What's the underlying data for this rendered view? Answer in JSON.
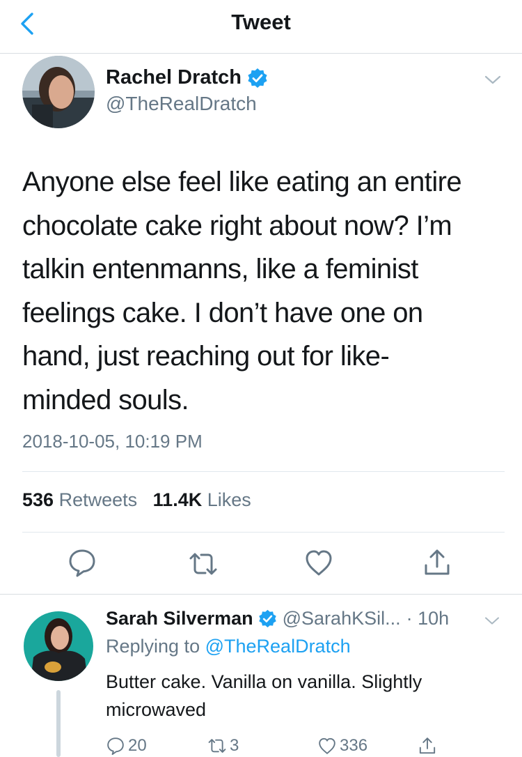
{
  "nav": {
    "title": "Tweet"
  },
  "tweet": {
    "author_name": "Rachel Dratch",
    "author_handle": "@TheRealDratch",
    "text_lines": [
      "Anyone else feel like eating an entire",
      "chocolate cake right about now? I’m",
      "talkin entenmanns, like a feminist",
      "feelings cake. I don’t have one on",
      "hand, just reaching out for like-",
      "minded souls."
    ],
    "timestamp": "2018-10-05, 10:19 PM",
    "retweets_count": "536",
    "retweets_label": "Retweets",
    "likes_count": "11.4K",
    "likes_label": "Likes"
  },
  "reply": {
    "author_name": "Sarah Silverman",
    "author_handle": "@SarahKSil...",
    "time": "· 10h",
    "replying_prefix": "Replying to",
    "replying_to": "@TheRealDratch",
    "text": "Butter cake. Vanilla on vanilla. Slightly microwaved",
    "replies_count": "20",
    "retweets_count": "3",
    "likes_count": "336"
  },
  "colors": {
    "accent": "#1da1f2",
    "secondary_text": "#657786",
    "primary_text": "#14171a",
    "divider": "#e1e8ed"
  },
  "icons": [
    "back-chevron-icon",
    "verified-badge-icon",
    "chevron-down-icon",
    "reply-icon",
    "retweet-icon",
    "like-icon",
    "share-icon"
  ]
}
